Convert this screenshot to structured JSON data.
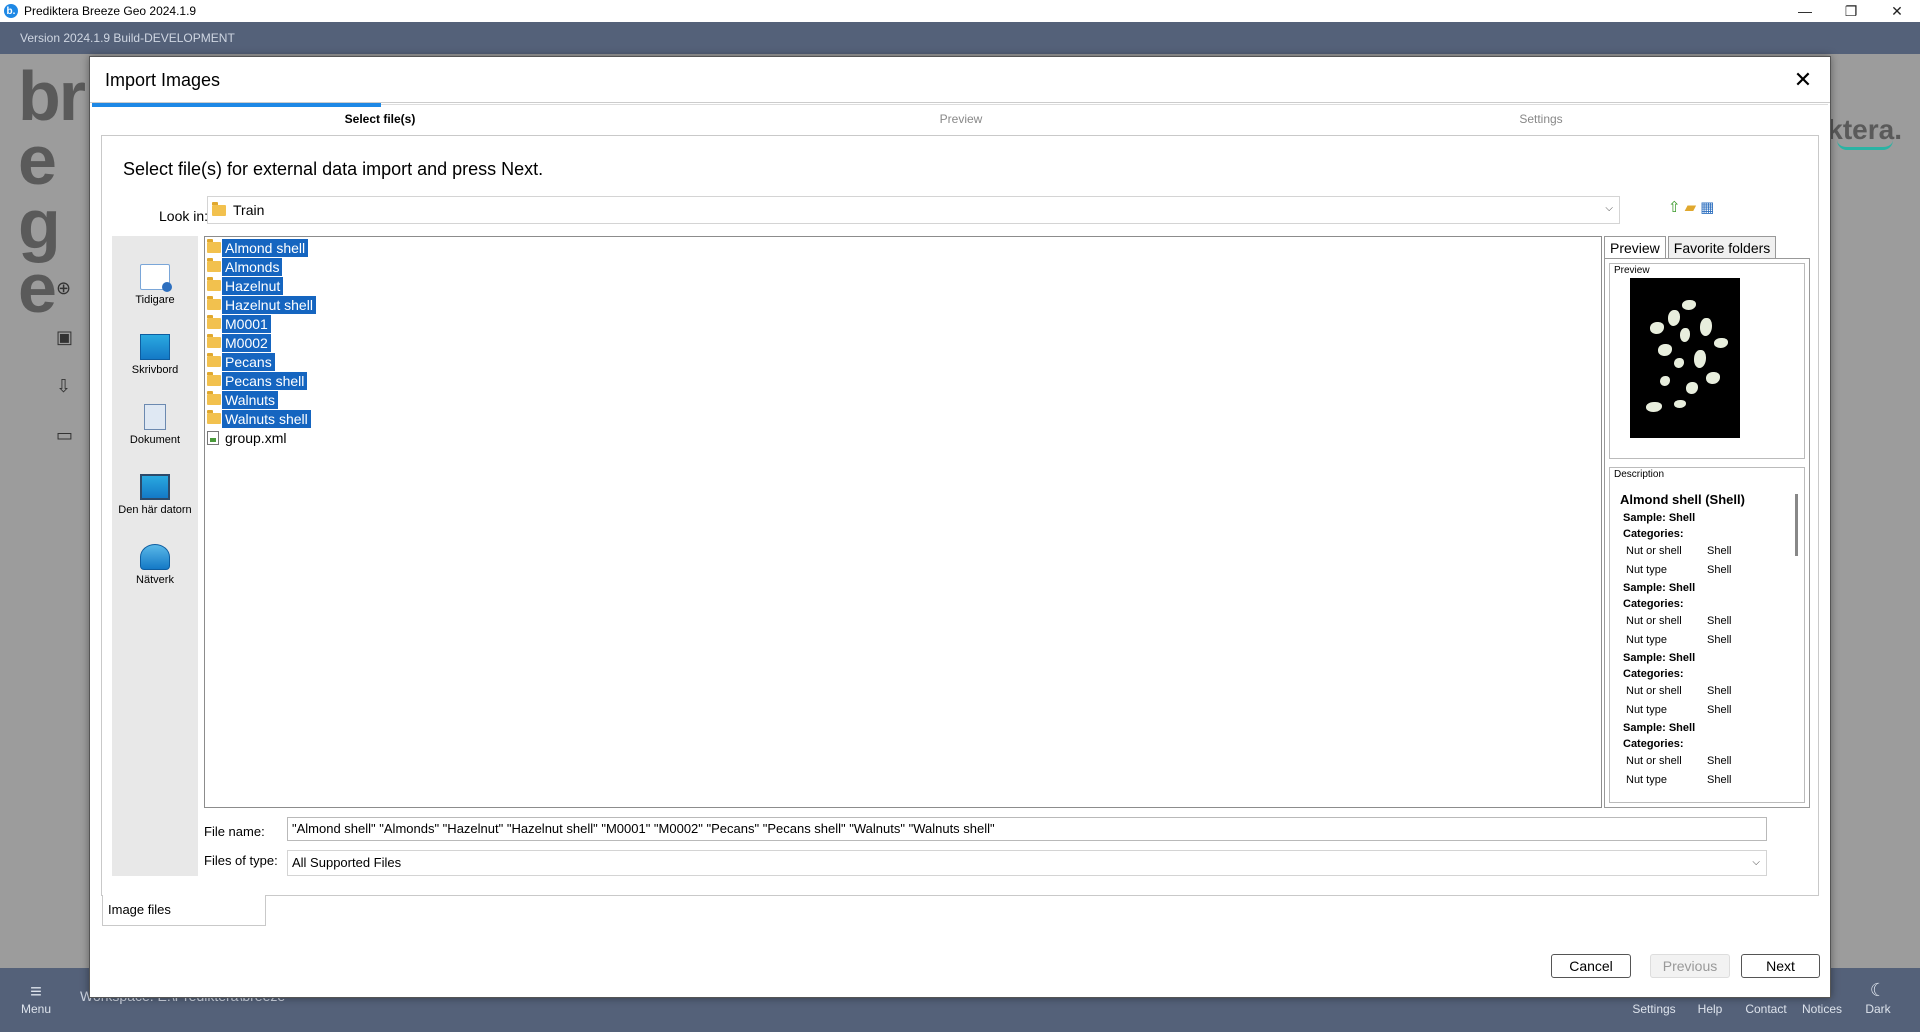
{
  "window": {
    "title": "Prediktera Breeze Geo 2024.1.9",
    "app_icon": "b.",
    "minimize": "—",
    "maximize": "❐",
    "close": "✕"
  },
  "app": {
    "version": "Version 2024.1.9 Build-DEVELOPMENT",
    "brand_big": "bre ge",
    "brand_right": "ktera.",
    "accent_color": "#1e88e5",
    "selection_color": "#1565c0"
  },
  "bottombar": {
    "menu_label": "Menu",
    "workspace": "Workspace:  E:\\Prediktera\\breeze",
    "actions": [
      {
        "label": "Settings",
        "icon": "gear-icon"
      },
      {
        "label": "Help",
        "icon": "help-icon"
      },
      {
        "label": "Contact",
        "icon": "contact-icon"
      },
      {
        "label": "Notices",
        "icon": "bell-icon"
      },
      {
        "label": "Dark",
        "icon": "moon-icon"
      }
    ]
  },
  "dialog": {
    "title": "Import Images",
    "steps": [
      "Select file(s)",
      "Preview",
      "Settings"
    ],
    "instruction": "Select file(s) for external data import and press Next.",
    "look_in_label": "Look in:",
    "look_in_value": "Train",
    "places": [
      "Tidigare",
      "Skrivbord",
      "Dokument",
      "Den här datorn",
      "Nätverk"
    ],
    "files": [
      {
        "name": "Almond shell",
        "type": "folder",
        "selected": true
      },
      {
        "name": "Almonds",
        "type": "folder",
        "selected": true
      },
      {
        "name": "Hazelnut",
        "type": "folder",
        "selected": true
      },
      {
        "name": "Hazelnut shell",
        "type": "folder",
        "selected": true
      },
      {
        "name": "M0001",
        "type": "folder",
        "selected": true
      },
      {
        "name": "M0002",
        "type": "folder",
        "selected": true
      },
      {
        "name": "Pecans",
        "type": "folder",
        "selected": true
      },
      {
        "name": "Pecans shell",
        "type": "folder",
        "selected": true
      },
      {
        "name": "Walnuts",
        "type": "folder",
        "selected": true
      },
      {
        "name": "Walnuts shell",
        "type": "folder",
        "selected": true
      },
      {
        "name": "group.xml",
        "type": "xml",
        "selected": false
      }
    ],
    "accessory_tabs": [
      "Preview",
      "Favorite folders"
    ],
    "preview_label": "Preview",
    "description_label": "Description",
    "description": {
      "title": "Almond shell (Shell)",
      "blocks": [
        {
          "sample": "Sample: Shell",
          "categories": "Categories:",
          "rows": [
            [
              "Nut or shell",
              "Shell"
            ],
            [
              "Nut type",
              "Shell"
            ]
          ]
        },
        {
          "sample": "Sample: Shell",
          "categories": "Categories:",
          "rows": [
            [
              "Nut or shell",
              "Shell"
            ],
            [
              "Nut type",
              "Shell"
            ]
          ]
        },
        {
          "sample": "Sample: Shell",
          "categories": "Categories:",
          "rows": [
            [
              "Nut or shell",
              "Shell"
            ],
            [
              "Nut type",
              "Shell"
            ]
          ]
        },
        {
          "sample": "Sample: Shell",
          "categories": "Categories:",
          "rows": [
            [
              "Nut or shell",
              "Shell"
            ],
            [
              "Nut type",
              "Shell"
            ]
          ]
        }
      ]
    },
    "file_name_label": "File name:",
    "file_name_value": "\"Almond shell\" \"Almonds\" \"Hazelnut\" \"Hazelnut shell\" \"M0001\" \"M0002\" \"Pecans\" \"Pecans shell\" \"Walnuts\" \"Walnuts shell\"",
    "files_of_type_label": "Files of type:",
    "files_of_type_value": "All Supported Files",
    "bottom_tab": "Image files",
    "buttons": {
      "cancel": "Cancel",
      "previous": "Previous",
      "next": "Next"
    }
  }
}
